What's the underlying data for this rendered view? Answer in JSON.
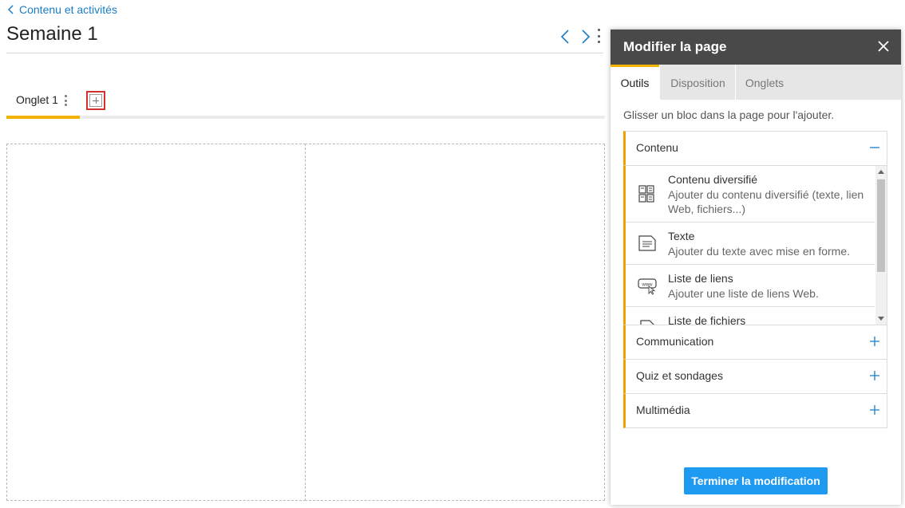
{
  "header": {
    "back_link": "Contenu et activités",
    "title": "Semaine 1"
  },
  "tabs": {
    "active_label": "Onglet 1"
  },
  "panel": {
    "title": "Modifier la page",
    "tabs": [
      "Outils",
      "Disposition",
      "Onglets"
    ],
    "hint": "Glisser un bloc dans la page pour l'ajouter.",
    "sections": {
      "contenu": "Contenu",
      "communication": "Communication",
      "quiz": "Quiz et sondages",
      "multimedia": "Multimédia"
    },
    "items": [
      {
        "title": "Contenu diversifié",
        "desc": "Ajouter du contenu diversifié (texte, lien Web, fichiers...)"
      },
      {
        "title": "Texte",
        "desc": "Ajouter du texte avec mise en forme."
      },
      {
        "title": "Liste de liens",
        "desc": "Ajouter une liste de liens Web."
      },
      {
        "title": "Liste de fichiers",
        "desc": ""
      }
    ],
    "finish_button": "Terminer la modification"
  },
  "colors": {
    "accent": "#f2b200",
    "link": "#1b7dc8",
    "button": "#1e9bf0",
    "highlight": "#d0332e"
  }
}
